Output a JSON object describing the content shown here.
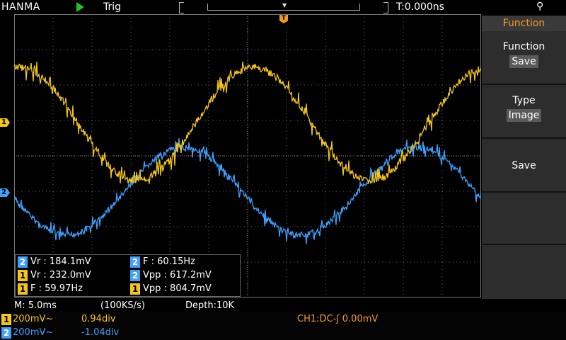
{
  "header": {
    "brand": "HANMA",
    "run_state": "Trig",
    "trigger_time": "T:0.000ns"
  },
  "markers": {
    "ch1": "1",
    "ch2": "2",
    "trigger": "T"
  },
  "measurements": [
    {
      "channel": "2",
      "text": "Vr : 184.1mV",
      "color": "blue"
    },
    {
      "channel": "2",
      "text": "F : 60.15Hz",
      "color": "blue"
    },
    {
      "channel": "1",
      "text": "Vr : 232.0mV",
      "color": "yellow"
    },
    {
      "channel": "2",
      "text": "Vpp : 617.2mV",
      "color": "blue"
    },
    {
      "channel": "1",
      "text": "F : 59.97Hz",
      "color": "yellow"
    },
    {
      "channel": "1",
      "text": "Vpp : 804.7mV",
      "color": "yellow"
    }
  ],
  "menu": {
    "title": "Function",
    "items": [
      {
        "label": "Function",
        "value": "Save"
      },
      {
        "label": "Type",
        "value": "Image"
      },
      {
        "label": "Save",
        "value": ""
      }
    ]
  },
  "status": {
    "timebase": "M: 5.0ms",
    "sample_rate": "(100KS/s)",
    "depth": "Depth:10K"
  },
  "channels": [
    {
      "num": "1",
      "scale": "200mV~",
      "offset": "0.94div",
      "color": "#f5c518"
    },
    {
      "num": "2",
      "scale": "200mV~",
      "offset": "-1.04div",
      "color": "#3ea0ff"
    }
  ],
  "trigger_info": "CH1:DC-ʃ 0.00mV"
}
